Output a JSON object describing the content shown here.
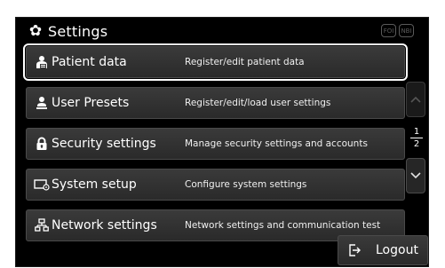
{
  "header": {
    "title": "Settings",
    "indicator_1": "FOI",
    "indicator_2": "NBI"
  },
  "menu": {
    "items": [
      {
        "label": "Patient data",
        "description": "Register/edit patient data",
        "icon": "patient-icon"
      },
      {
        "label": "User Presets",
        "description": "Register/edit/load user settings",
        "icon": "user-presets-icon"
      },
      {
        "label": "Security settings",
        "description": "Manage security settings and accounts",
        "icon": "lock-icon"
      },
      {
        "label": "System setup",
        "description": "Configure system settings",
        "icon": "system-setup-icon"
      },
      {
        "label": "Network settings",
        "description": "Network settings and communication test",
        "icon": "network-icon"
      }
    ]
  },
  "scroll": {
    "current_page": "1",
    "total_pages": "2"
  },
  "footer": {
    "logout_label": "Logout"
  }
}
